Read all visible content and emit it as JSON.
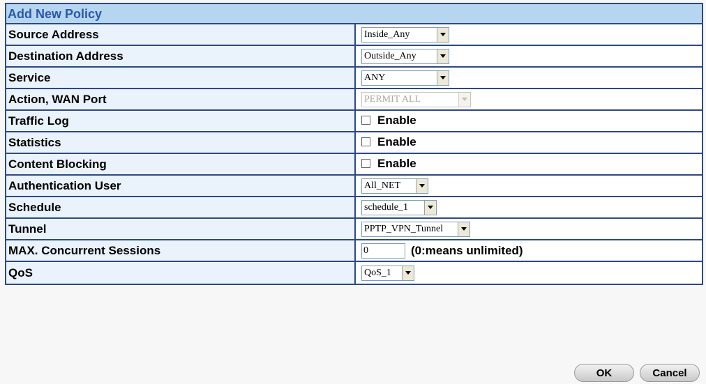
{
  "form": {
    "title": "Add New Policy",
    "rows": [
      {
        "label": "Source Address",
        "type": "select",
        "value": "Inside_Any",
        "width": 126
      },
      {
        "label": "Destination Address",
        "type": "select",
        "value": "Outside_Any",
        "width": 126
      },
      {
        "label": "Service",
        "type": "select",
        "value": "ANY",
        "width": 126
      },
      {
        "label": "Action, WAN Port",
        "type": "select",
        "value": "PERMIT ALL",
        "disabled": true,
        "width": 157
      },
      {
        "label": "Traffic Log",
        "type": "checkbox",
        "text": "Enable",
        "checked": false
      },
      {
        "label": "Statistics",
        "type": "checkbox",
        "text": "Enable",
        "checked": false
      },
      {
        "label": "Content Blocking",
        "type": "checkbox",
        "text": "Enable",
        "checked": false
      },
      {
        "label": "Authentication User",
        "type": "select",
        "value": "All_NET",
        "width": 96
      },
      {
        "label": "Schedule",
        "type": "select",
        "value": "schedule_1",
        "width": 108
      },
      {
        "label": "Tunnel",
        "type": "select",
        "value": "PPTP_VPN_Tunnel",
        "width": 156
      },
      {
        "label": "MAX. Concurrent Sessions",
        "type": "input",
        "value": "0",
        "hint": "(0:means unlimited)"
      },
      {
        "label": "QoS",
        "type": "select",
        "value": "QoS_1",
        "width": 76
      }
    ]
  },
  "buttons": {
    "ok_label": "OK",
    "cancel_label": "Cancel"
  },
  "colors": {
    "border": "#2c4a82",
    "header_bg": "#b6d5f0",
    "header_text": "#2a59a6",
    "label_bg": "#eaf2fb"
  }
}
